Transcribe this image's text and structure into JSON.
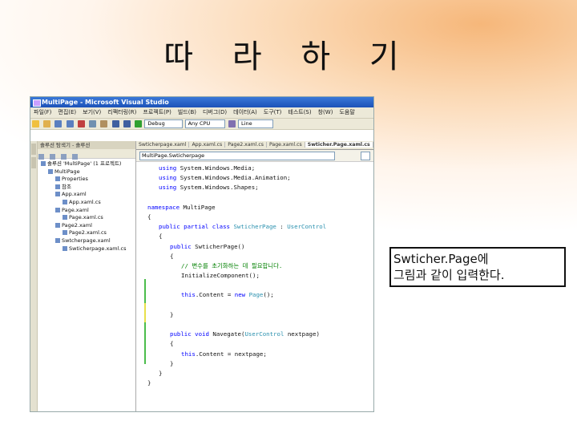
{
  "slide": {
    "title": "따 라 하 기",
    "caption_line1": "Swticher.Page에",
    "caption_line2": "그림과 같이 입력한다."
  },
  "window": {
    "title": "MultiPage - Microsoft Visual Studio",
    "menu": [
      "파일(F)",
      "편집(E)",
      "보기(V)",
      "리팩터링(R)",
      "프로젝트(P)",
      "빌드(B)",
      "디버그(D)",
      "데이터(A)",
      "도구(T)",
      "테스트(S)",
      "창(W)",
      "도움말"
    ],
    "toolbar": {
      "config": "Debug",
      "platform": "Any CPU",
      "find": "Line"
    }
  },
  "solution_explorer": {
    "header": "솔루션 탐색기 - 솔루션",
    "items": [
      "솔루션 'MultiPage' (1 프로젝트)",
      "MultiPage",
      "Properties",
      "참조",
      "App.xaml",
      "App.xaml.cs",
      "Page.xaml",
      "Page.xaml.cs",
      "Page2.xaml",
      "Page2.xaml.cs",
      "Swtcherpage.xaml",
      "Swticherpage.xaml.cs"
    ]
  },
  "editor": {
    "tabs": [
      "Swticherpage.xaml",
      "App.xaml.cs",
      "Page2.xaml.cs",
      "Page.xaml.cs",
      "Swticher.Page.xaml.cs"
    ],
    "nav_combo": "MultiPage.Swticherpage",
    "lines": [
      {
        "indent": 1,
        "parts": [
          [
            "kw",
            "using"
          ],
          [
            "txt",
            " System.Windows.Media;"
          ]
        ]
      },
      {
        "indent": 1,
        "parts": [
          [
            "kw",
            "using"
          ],
          [
            "txt",
            " System.Windows.Media.Animation;"
          ]
        ]
      },
      {
        "indent": 1,
        "parts": [
          [
            "kw",
            "using"
          ],
          [
            "txt",
            " System.Windows.Shapes;"
          ]
        ]
      },
      {
        "indent": 0,
        "parts": [
          [
            "txt",
            ""
          ]
        ]
      },
      {
        "indent": 0,
        "parts": [
          [
            "kw",
            "namespace"
          ],
          [
            "txt",
            " MultiPage"
          ]
        ]
      },
      {
        "indent": 0,
        "parts": [
          [
            "txt",
            "{"
          ]
        ]
      },
      {
        "indent": 1,
        "parts": [
          [
            "kw",
            "public partial class"
          ],
          [
            "txt",
            " "
          ],
          [
            "ty",
            "SwticherPage"
          ],
          [
            "txt",
            " : "
          ],
          [
            "ty",
            "UserControl"
          ]
        ]
      },
      {
        "indent": 1,
        "parts": [
          [
            "txt",
            "{"
          ]
        ]
      },
      {
        "indent": 2,
        "parts": [
          [
            "kw",
            "public"
          ],
          [
            "txt",
            " SwticherPage()"
          ]
        ]
      },
      {
        "indent": 2,
        "parts": [
          [
            "txt",
            "{"
          ]
        ]
      },
      {
        "indent": 3,
        "parts": [
          [
            "cm",
            "// 변수를 초기화하는 데 필요합니다."
          ]
        ]
      },
      {
        "indent": 3,
        "parts": [
          [
            "txt",
            "InitializeComponent();"
          ]
        ]
      },
      {
        "indent": 0,
        "parts": [
          [
            "txt",
            ""
          ]
        ]
      },
      {
        "indent": 3,
        "parts": [
          [
            "kw",
            "this"
          ],
          [
            "txt",
            ".Content = "
          ],
          [
            "kw",
            "new"
          ],
          [
            "txt",
            " "
          ],
          [
            "ty",
            "Page"
          ],
          [
            "txt",
            "();"
          ]
        ]
      },
      {
        "indent": 0,
        "parts": [
          [
            "txt",
            ""
          ]
        ]
      },
      {
        "indent": 2,
        "parts": [
          [
            "txt",
            "}"
          ]
        ]
      },
      {
        "indent": 0,
        "parts": [
          [
            "txt",
            ""
          ]
        ]
      },
      {
        "indent": 2,
        "parts": [
          [
            "kw",
            "public void"
          ],
          [
            "txt",
            " Navegate("
          ],
          [
            "ty",
            "UserControl"
          ],
          [
            "txt",
            " nextpage)"
          ]
        ]
      },
      {
        "indent": 2,
        "parts": [
          [
            "txt",
            "{"
          ]
        ]
      },
      {
        "indent": 3,
        "parts": [
          [
            "kw",
            "this"
          ],
          [
            "txt",
            ".Content = nextpage;"
          ]
        ]
      },
      {
        "indent": 2,
        "parts": [
          [
            "txt",
            "}"
          ]
        ]
      },
      {
        "indent": 1,
        "parts": [
          [
            "txt",
            "}"
          ]
        ]
      },
      {
        "indent": 0,
        "parts": [
          [
            "txt",
            "}"
          ]
        ]
      }
    ]
  },
  "colors": {
    "keyword": "#0000ff",
    "type": "#2b91af",
    "comment": "#008000",
    "titlebar": "#1c52b8"
  }
}
